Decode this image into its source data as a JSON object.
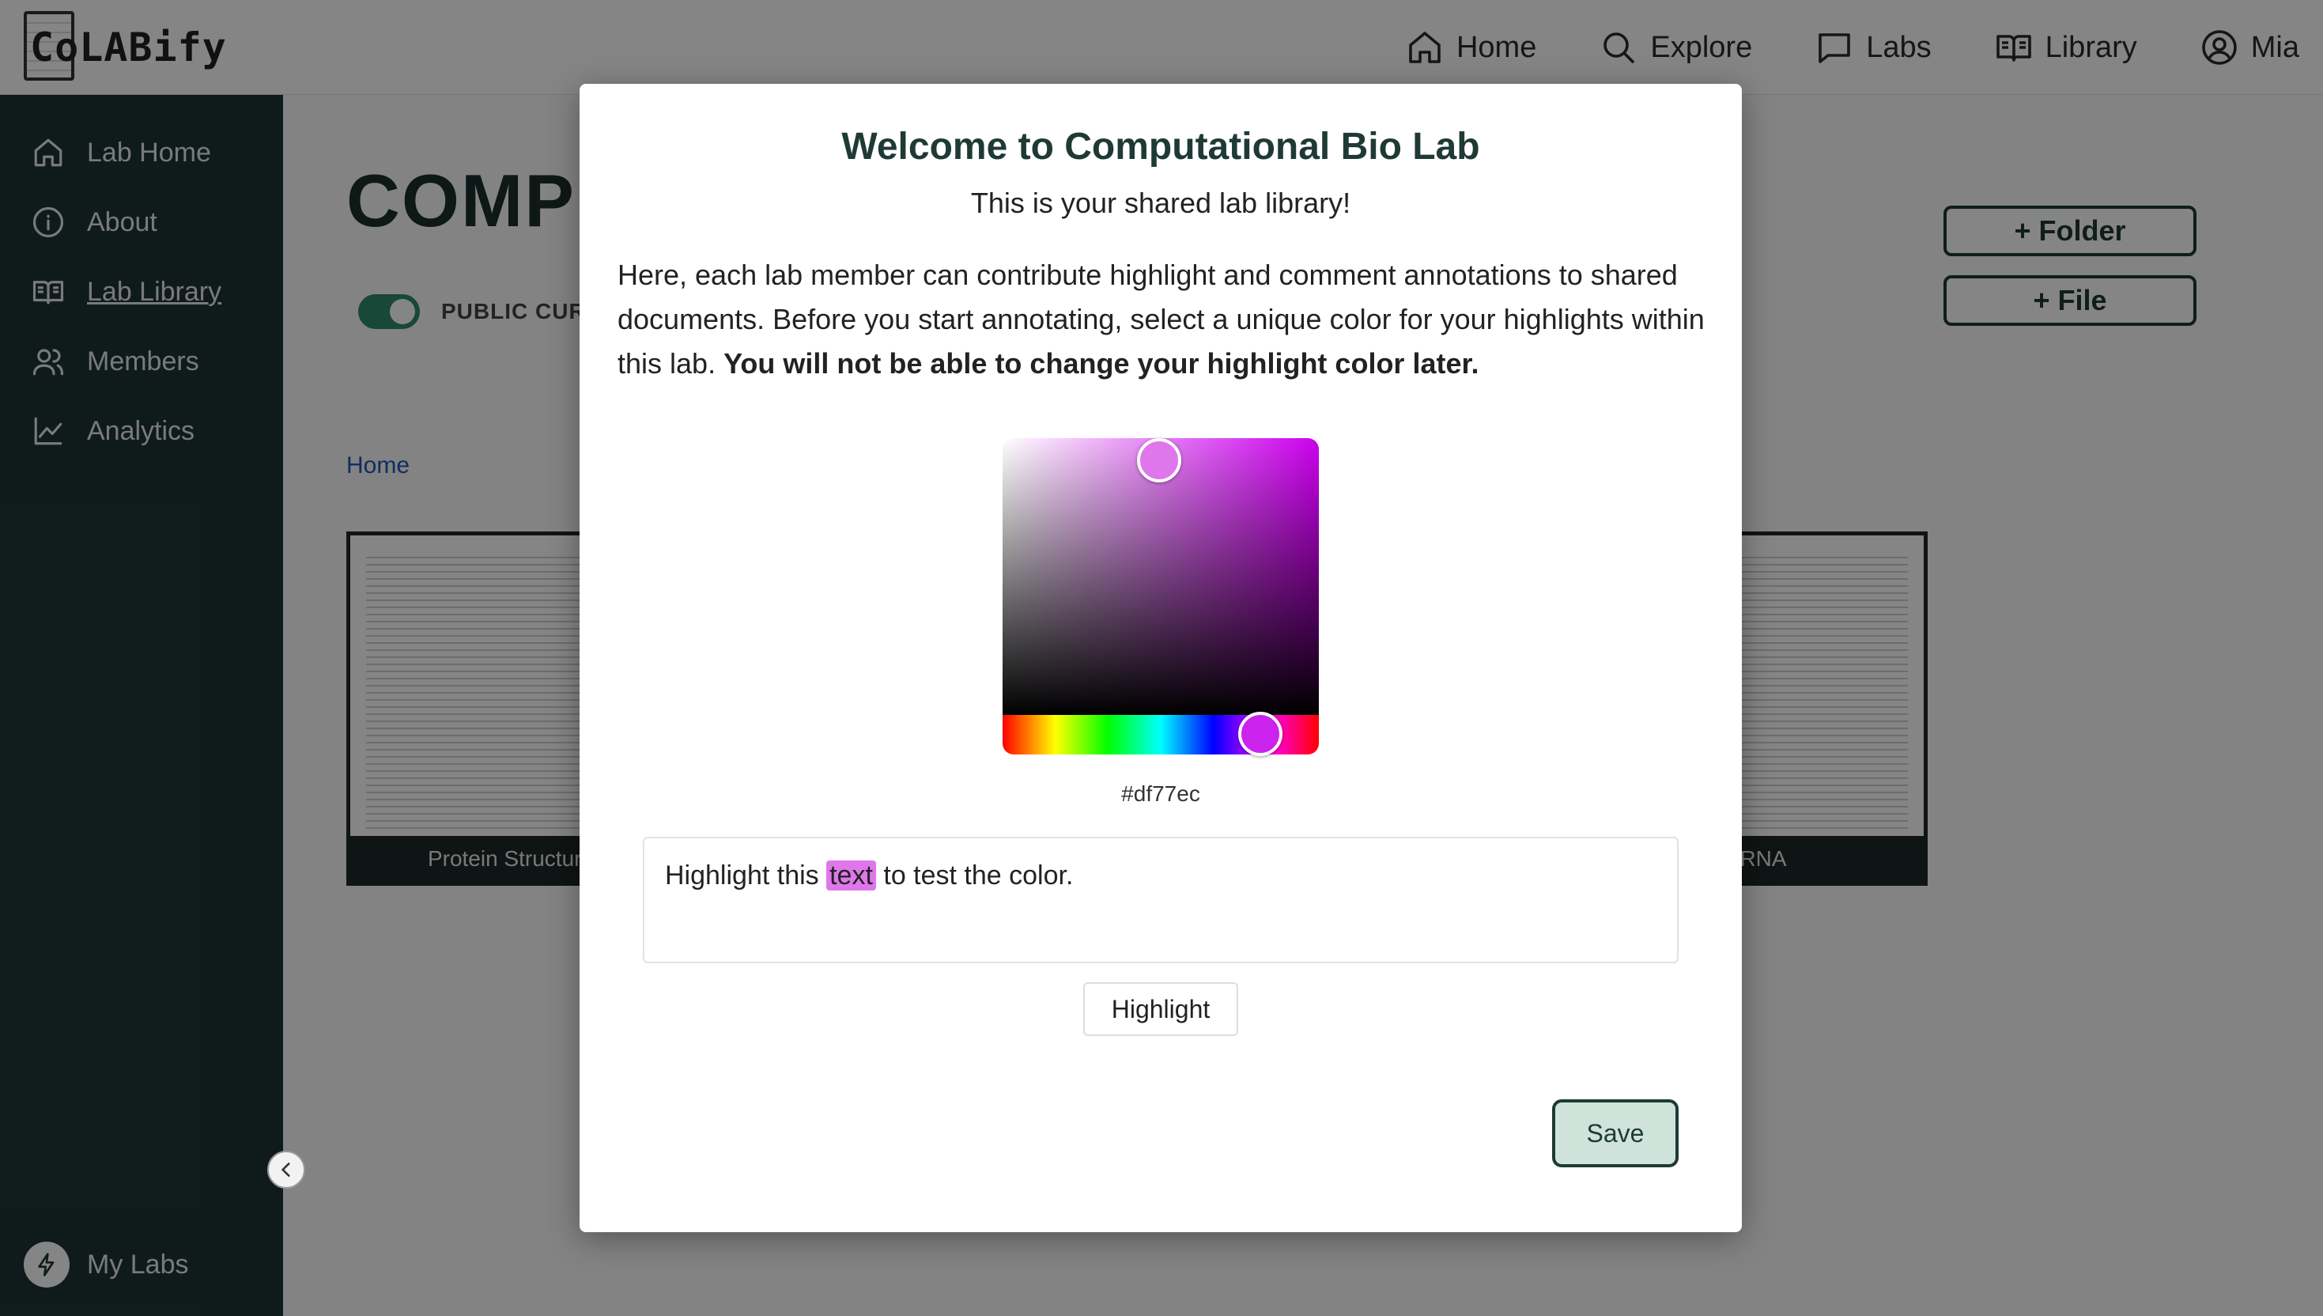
{
  "header": {
    "logo_text": "CoLABify",
    "nav": [
      {
        "label": "Home",
        "icon": "home-icon"
      },
      {
        "label": "Explore",
        "icon": "search-icon"
      },
      {
        "label": "Labs",
        "icon": "chat-icon"
      },
      {
        "label": "Library",
        "icon": "book-open-icon"
      },
      {
        "label": "Mia",
        "icon": "user-circle-icon"
      }
    ]
  },
  "sidebar": {
    "items": [
      {
        "label": "Lab Home",
        "icon": "home-icon"
      },
      {
        "label": "About",
        "icon": "info-icon"
      },
      {
        "label": "Lab Library",
        "icon": "book-open-icon",
        "active": true
      },
      {
        "label": "Members",
        "icon": "users-icon"
      },
      {
        "label": "Analytics",
        "icon": "line-chart-icon"
      }
    ],
    "my_labs": "My Labs"
  },
  "main": {
    "title_visible": "COMPU",
    "public_label": "PUBLIC CURR",
    "add_folder": "+ Folder",
    "add_file": "+ File",
    "breadcrumb": "Home",
    "documents": [
      {
        "label": "Protein Structure"
      },
      {
        "label": "RNA"
      }
    ]
  },
  "modal": {
    "title": "Welcome to Computational Bio Lab",
    "subtitle": "This is your shared lab library!",
    "body_text": "Here, each lab member can contribute highlight and comment annotations to shared documents. Before you start annotating, select a unique color for your highlights within this lab.",
    "body_bold": "You will not be able to change your highlight color later.",
    "hex_value": "#df77ec",
    "test_text_before": "Highlight this",
    "test_text_highlight": "text",
    "test_text_after": "to test the color.",
    "highlight_button": "Highlight",
    "save_button": "Save"
  },
  "colors": {
    "sidebar_bg": "#1d3533",
    "accent_dark": "#1f3a35",
    "selected_highlight": "#df77ec",
    "save_bg": "#cfe3da",
    "toggle_on": "#2f8a6a"
  }
}
